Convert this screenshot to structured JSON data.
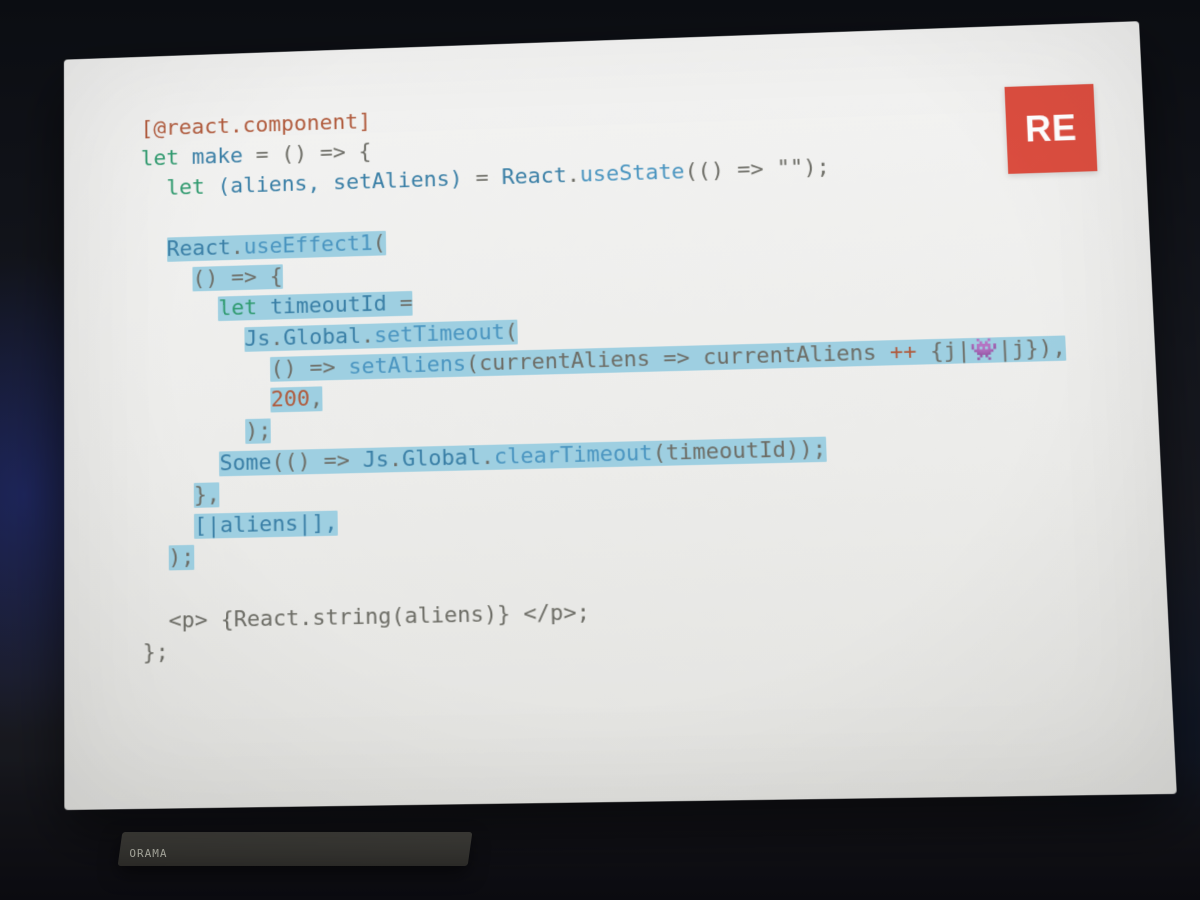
{
  "logo": "RE",
  "stand_brand": "ORAMA",
  "code": {
    "l1_attr": "[@react.component]",
    "l2_let": "let",
    "l2_make": "make",
    "l2_rest": " = () => {",
    "l3_let": "let",
    "l3_dest": "(aliens, setAliens)",
    "l3_eq": " = ",
    "l3_react": "React",
    "l3_use": "useState",
    "l3_tail": "(() => \"\");",
    "l5_react": "React",
    "l5_ue": "useEffect1",
    "l5_open": "(",
    "l6": "() => {",
    "l7_let": "let",
    "l7_id": " timeoutId",
    "l7_eq": " =",
    "l8_js": "Js",
    "l8_glob": "Global",
    "l8_sto": "setTimeout",
    "l8_open": "(",
    "l9_a": "() => ",
    "l9_set": "setAliens",
    "l9_b": "(currentAliens => currentAliens ",
    "l9_pp": "++",
    "l9_c": " {j|👾|j}),",
    "l10_num": "200",
    "l10_comma": ",",
    "l11": ");",
    "l12_some": "Some",
    "l12_a": "(() => ",
    "l12_js": "Js",
    "l12_glob": "Global",
    "l12_ct": "clearTimeout",
    "l12_b": "(timeoutId));",
    "l13": "},",
    "l14": "[|aliens|],",
    "l15": ");",
    "l17": "<p> {React.string(aliens)} </p>;",
    "l18": "};"
  }
}
